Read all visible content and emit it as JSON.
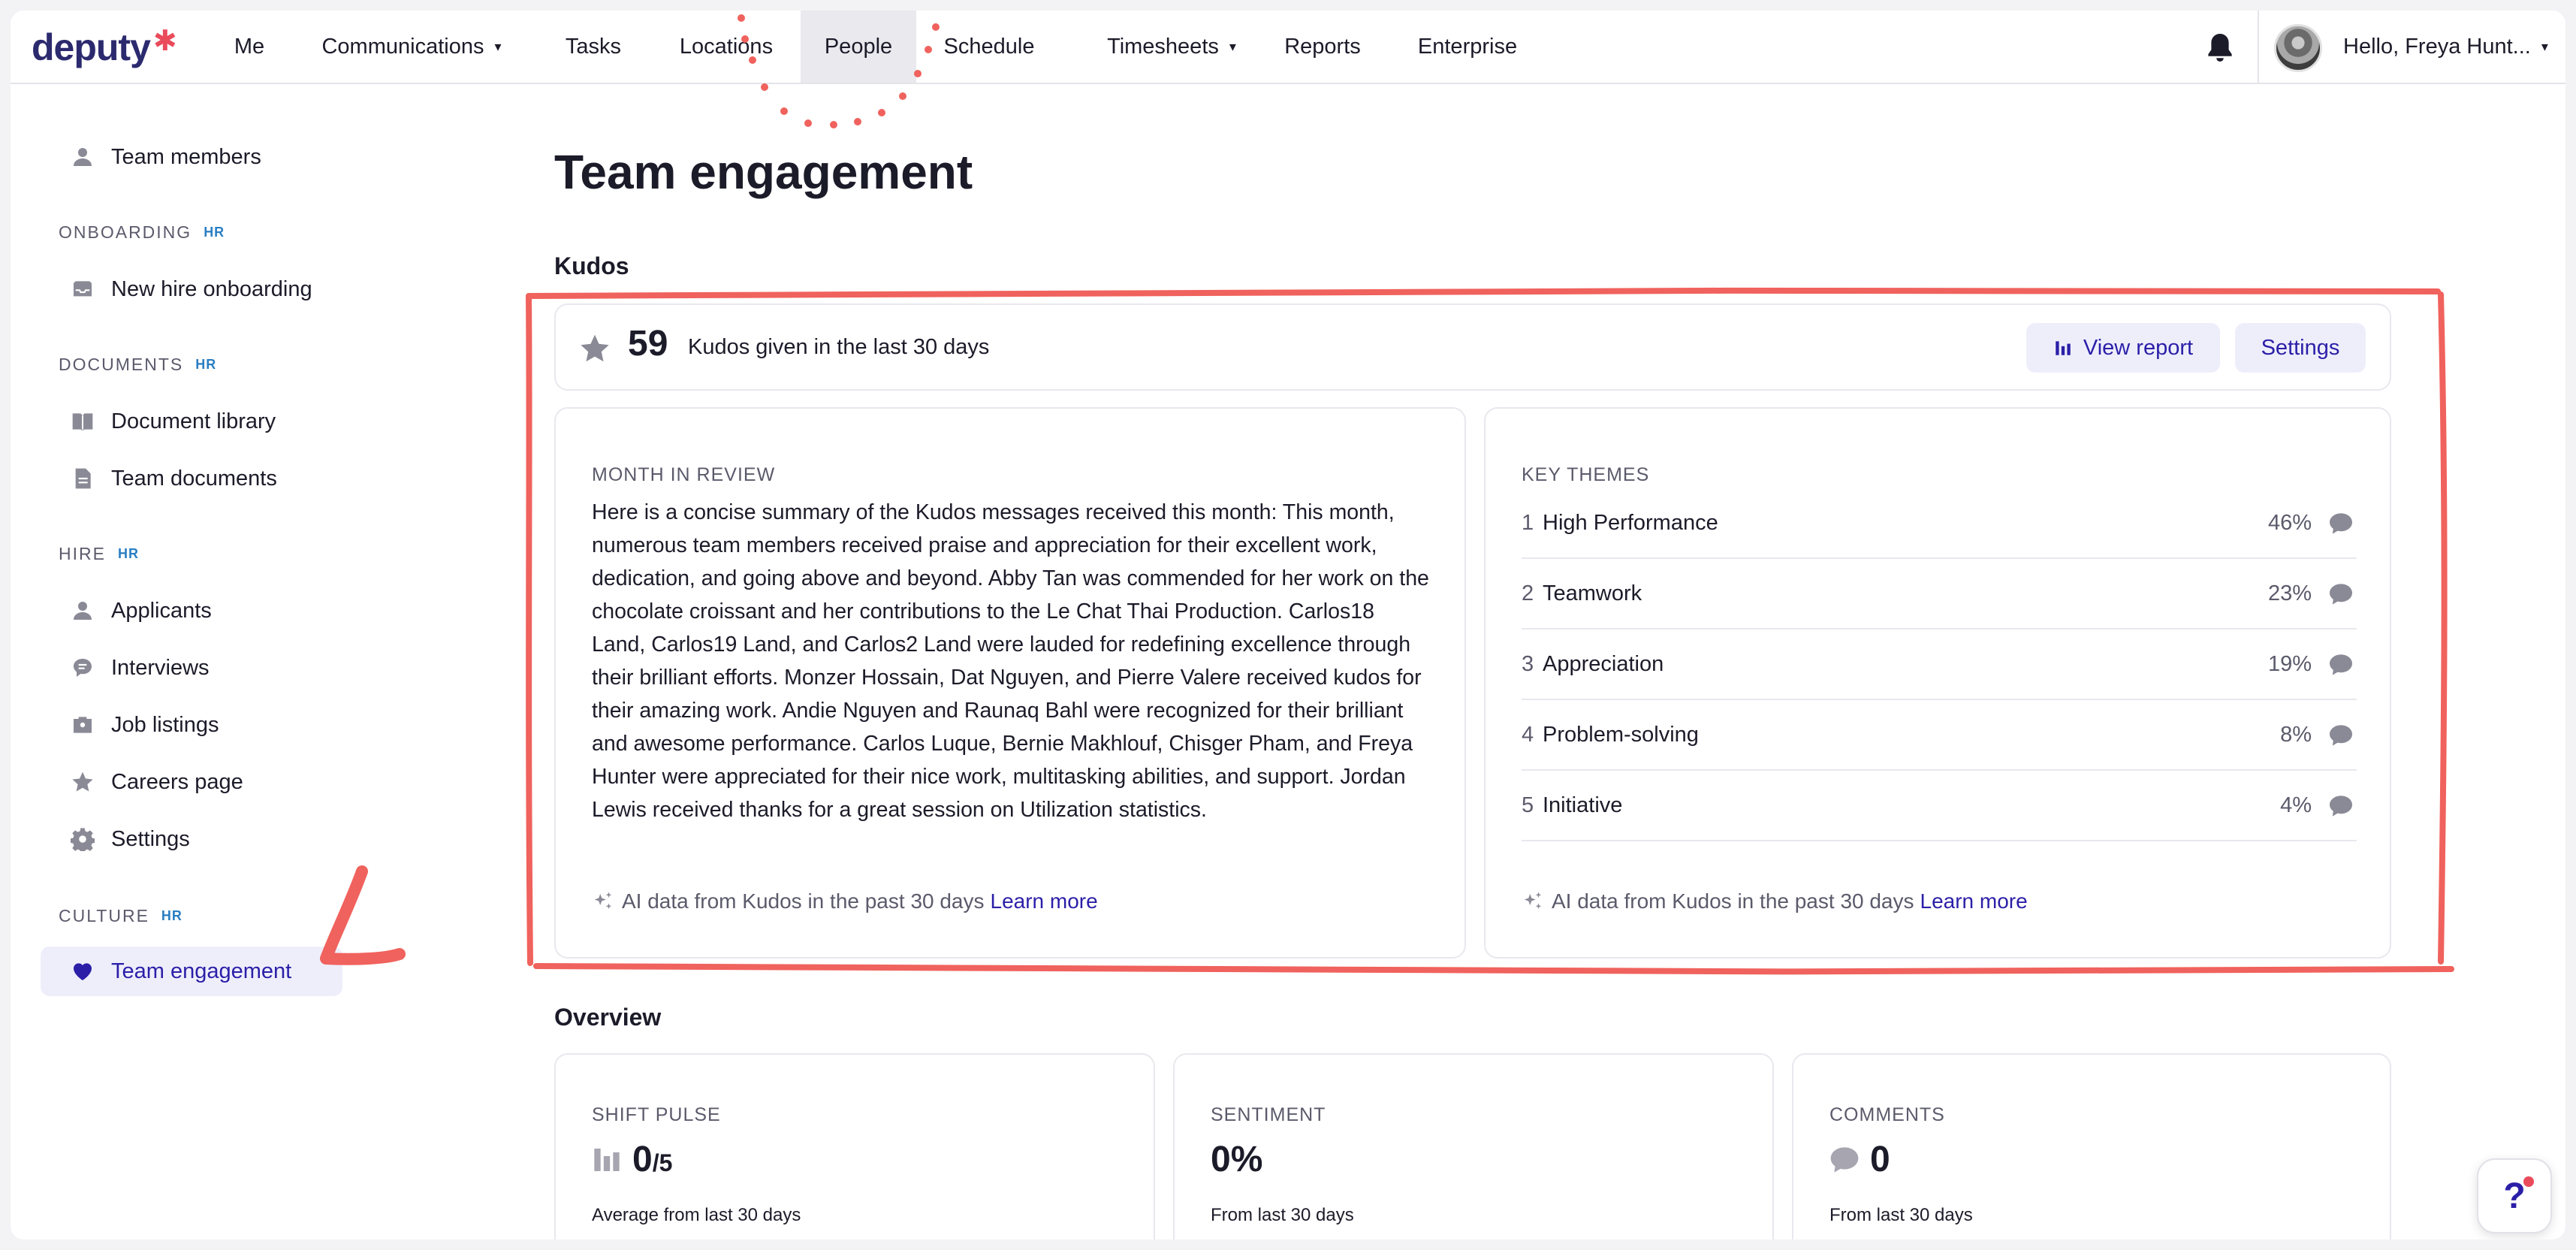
{
  "brand": {
    "logo_text": "deputy",
    "logo_mark": "✱"
  },
  "topnav": {
    "items": [
      {
        "label": "Me",
        "caret": ""
      },
      {
        "label": "Communications",
        "caret": "▾"
      },
      {
        "label": "Tasks",
        "caret": ""
      },
      {
        "label": "Locations",
        "caret": ""
      },
      {
        "label": "People",
        "caret": ""
      },
      {
        "label": "Schedule",
        "caret": ""
      },
      {
        "label": "Timesheets",
        "caret": "▾"
      },
      {
        "label": "Reports",
        "caret": ""
      },
      {
        "label": "Enterprise",
        "caret": ""
      }
    ],
    "active": "People",
    "user_greeting": "Hello, Freya Hunt...",
    "user_caret": "▾"
  },
  "sidebar": {
    "top_item": "Team members",
    "sections": [
      {
        "title": "ONBOARDING",
        "badge": "HR",
        "items": [
          "New hire onboarding"
        ]
      },
      {
        "title": "DOCUMENTS",
        "badge": "HR",
        "items": [
          "Document library",
          "Team documents"
        ]
      },
      {
        "title": "HIRE",
        "badge": "HR",
        "items": [
          "Applicants",
          "Interviews",
          "Job listings",
          "Careers page",
          "Settings"
        ]
      },
      {
        "title": "CULTURE",
        "badge": "HR",
        "items": [
          "Team engagement"
        ]
      }
    ],
    "active_item": "Team engagement"
  },
  "page": {
    "title": "Team engagement",
    "kudos_heading": "Kudos",
    "kudos": {
      "count": "59",
      "description": "Kudos given in the last 30 days",
      "view_report_label": "View report",
      "settings_label": "Settings"
    },
    "review": {
      "heading": "MONTH IN REVIEW",
      "text": "Here is a concise summary of the Kudos messages received this month: This month, numerous team members received praise and appreciation for their excellent work, dedication, and going above and beyond. Abby Tan was commended for her work on the chocolate croissant and her contributions to the Le Chat Thai Production. Carlos18 Land, Carlos19 Land, and Carlos2 Land were lauded for redefining excellence through their brilliant efforts. Monzer Hossain, Dat Nguyen, and Pierre Valere received kudos for their amazing work. Andie Nguyen and Raunaq Bahl were recognized for their brilliant and awesome performance. Carlos Luque, Bernie Makhlouf, Chisger Pham, and Freya Hunter were appreciated for their nice work, multitasking abilities, and support. Jordan Lewis received thanks for a great session on Utilization statistics.",
      "ai_note": "AI data from Kudos in the past 30 days",
      "learn_more": "Learn more"
    },
    "themes": {
      "heading": "KEY THEMES",
      "rows": [
        {
          "num": "1",
          "name": "High Performance",
          "pct": "46%"
        },
        {
          "num": "2",
          "name": "Teamwork",
          "pct": "23%"
        },
        {
          "num": "3",
          "name": "Appreciation",
          "pct": "19%"
        },
        {
          "num": "4",
          "name": "Problem-solving",
          "pct": "8%"
        },
        {
          "num": "5",
          "name": "Initiative",
          "pct": "4%"
        }
      ],
      "ai_note": "AI data from Kudos in the past 30 days",
      "learn_more": "Learn more"
    },
    "overview_heading": "Overview",
    "overview": [
      {
        "heading": "SHIFT PULSE",
        "value": "0",
        "suffix": "/5",
        "sub": "Average from last 30 days",
        "icon": "bar-chart-icon"
      },
      {
        "heading": "SENTIMENT",
        "value": "0%",
        "suffix": "",
        "sub": "From last 30 days",
        "icon": ""
      },
      {
        "heading": "COMMENTS",
        "value": "0",
        "suffix": "",
        "sub": "From last 30 days",
        "icon": "comment-icon"
      }
    ],
    "help_label": "?"
  },
  "colors": {
    "accent": "#2b1fa8",
    "annotation": "#f0625d",
    "brand_mark": "#e94b5b"
  }
}
